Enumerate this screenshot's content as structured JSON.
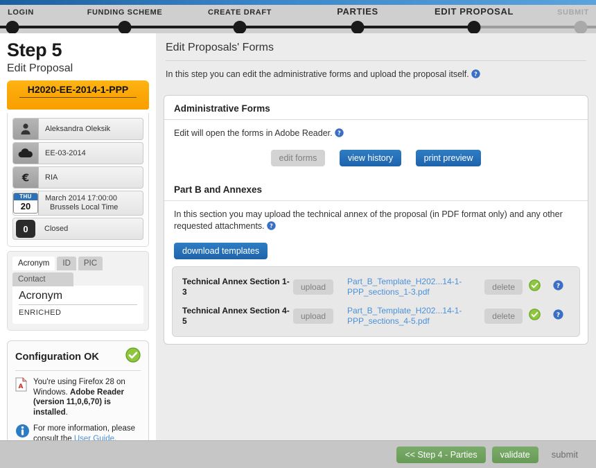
{
  "stepper": {
    "steps": [
      {
        "label": "LOGIN",
        "state": "done"
      },
      {
        "label": "FUNDING SCHEME",
        "state": "done"
      },
      {
        "label": "CREATE DRAFT",
        "state": "done"
      },
      {
        "label": "PARTIES",
        "state": "current"
      },
      {
        "label": "EDIT PROPOSAL",
        "state": "current"
      },
      {
        "label": "SUBMIT",
        "state": "todo"
      }
    ]
  },
  "sidebar": {
    "step_title": "Step 5",
    "step_subtitle": "Edit Proposal",
    "call_id": "H2020-EE-2014-1-PPP",
    "info_rows": [
      {
        "icon": "person-icon",
        "text": "Aleksandra Oleksik"
      },
      {
        "icon": "cloud-icon",
        "text": "EE-03-2014"
      },
      {
        "icon": "euro-icon",
        "text": "RIA"
      },
      {
        "icon": "calendar-icon",
        "weekday": "THU",
        "day": "20",
        "line1": "March 2014  17:00:00",
        "line2": "Brussels Local Time"
      },
      {
        "icon": "counter-badge",
        "count": "0",
        "text": "Closed"
      }
    ],
    "tabs": [
      {
        "label": "Acronym",
        "active": true
      },
      {
        "label": "ID",
        "active": false
      },
      {
        "label": "PIC",
        "active": false
      },
      {
        "label": "Contact",
        "active": false
      }
    ],
    "tab_panel": {
      "heading": "Acronym",
      "value": "ENRICHED"
    },
    "config": {
      "title": "Configuration OK",
      "status_icon": "green-check-icon",
      "browser_note_plain_1": "You're using Firefox 28 on Windows. ",
      "browser_note_bold_1": "Adobe Reader (version 11,0,6,70) is installed",
      "browser_note_plain_2": ".",
      "info_prefix": "For more information, please consult the ",
      "info_link": "User Guide",
      "info_suffix": "."
    }
  },
  "main": {
    "page_title": "Edit Proposals' Forms",
    "page_intro": "In this step you can edit the administrative forms and upload the proposal itself.",
    "admin_panel": {
      "title": "Administrative Forms",
      "description": "Edit will open the forms in Adobe Reader.",
      "buttons": [
        {
          "label": "edit forms",
          "style": "disabled"
        },
        {
          "label": "view history",
          "style": "blue"
        },
        {
          "label": "print preview",
          "style": "blue"
        }
      ]
    },
    "partb_panel": {
      "title": "Part B and Annexes",
      "description": "In this section you may upload the technical annex of the proposal (in PDF format only) and any other requested attachments.",
      "download_button": "download templates",
      "rows": [
        {
          "name": "Technical Annex Section 1-3",
          "upload_label": "upload",
          "file_link": "Part_B_Template_H202...14-1-PPP_sections_1-3.pdf",
          "delete_label": "delete",
          "status_icon": "green-check-icon",
          "help_icon": "help-icon"
        },
        {
          "name": "Technical Annex Section 4-5",
          "upload_label": "upload",
          "file_link": "Part_B_Template_H202...14-1-PPP_sections_4-5.pdf",
          "delete_label": "delete",
          "status_icon": "green-check-icon",
          "help_icon": "help-icon"
        }
      ]
    }
  },
  "footer": {
    "back_label": "<< Step 4 - Parties",
    "validate_label": "validate",
    "submit_label": "submit"
  }
}
